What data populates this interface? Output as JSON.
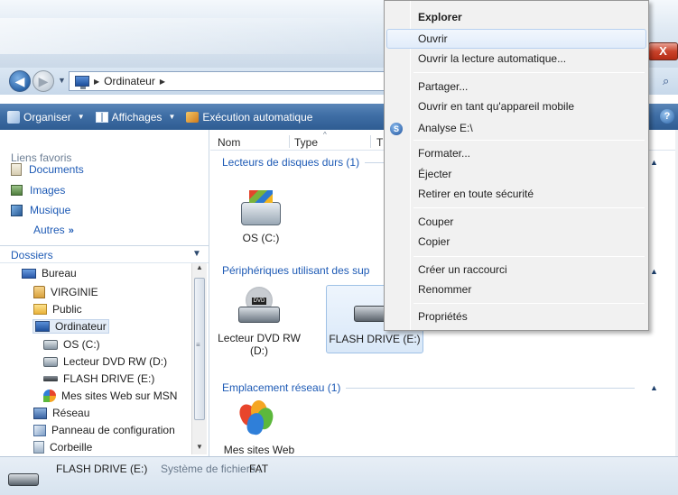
{
  "address": {
    "crumb": "Ordinateur"
  },
  "toolbar": {
    "organize": "Organiser",
    "views": "Affichages",
    "autorun": "Exécution automatique",
    "help": "?"
  },
  "window": {
    "close": "X"
  },
  "favorites": {
    "title": "Liens favoris",
    "items": [
      "Documents",
      "Images",
      "Musique"
    ],
    "more": "Autres"
  },
  "folders": {
    "title": "Dossiers",
    "tree": [
      "Bureau",
      "VIRGINIE",
      "Public",
      "Ordinateur",
      "OS (C:)",
      "Lecteur DVD RW (D:)",
      "FLASH DRIVE (E:)",
      "Mes sites Web sur MSN",
      "Réseau",
      "Panneau de configuration",
      "Corbeille"
    ]
  },
  "columns": [
    "Nom",
    "Type",
    "T"
  ],
  "groups": [
    {
      "title": "Lecteurs de disques durs (1)"
    },
    {
      "title": "Périphériques utilisant des sup"
    },
    {
      "title": "Emplacement réseau (1)"
    }
  ],
  "tiles": {
    "os": "OS (C:)",
    "dvd_line1": "Lecteur DVD RW",
    "dvd_line2": "(D:)",
    "dvd_badge": "DVD",
    "flash": "FLASH DRIVE (E:)",
    "msn": "Mes sites Web"
  },
  "details": {
    "name": "FLASH DRIVE (E:)",
    "fs_label": "Système de fichiers :",
    "fs_value": "FAT"
  },
  "context_menu": {
    "items": [
      "Explorer",
      "Ouvrir",
      "Ouvrir la lecture automatique...",
      "Partager...",
      "Ouvrir en tant qu'appareil mobile",
      "Analyse E:\\",
      "Formater...",
      "Éjecter",
      "Retirer en toute sécurité",
      "Couper",
      "Copier",
      "Créer un raccourci",
      "Renommer",
      "Propriétés"
    ]
  },
  "colors": {
    "link": "#1d5ab5",
    "toolbar": "#3f6ea5",
    "menu_bg": "#f1f1f1"
  }
}
